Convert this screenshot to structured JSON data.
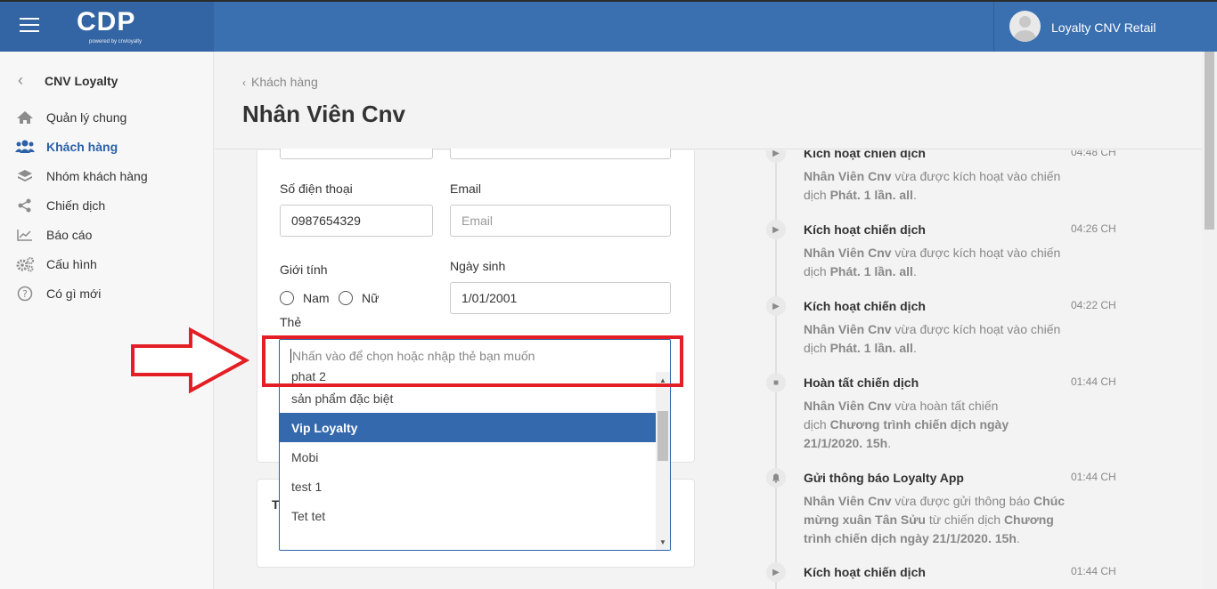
{
  "app": {
    "logo": "CDP",
    "logo_sub": "powered by cnvloyalty",
    "user_name": "Loyalty CNV Retail"
  },
  "sidebar": {
    "header": "CNV Loyalty",
    "items": [
      {
        "label": "Quản lý chung",
        "icon": "home-icon"
      },
      {
        "label": "Khách hàng",
        "icon": "users-icon",
        "active": true
      },
      {
        "label": "Nhóm khách hàng",
        "icon": "layers-icon"
      },
      {
        "label": "Chiến dịch",
        "icon": "share-icon"
      },
      {
        "label": "Báo cáo",
        "icon": "chart-icon"
      },
      {
        "label": "Cấu hình",
        "icon": "gears-icon"
      },
      {
        "label": "Có gì mới",
        "icon": "question-icon"
      }
    ]
  },
  "header": {
    "breadcrumb": "Khách hàng",
    "title": "Nhân Viên Cnv"
  },
  "form": {
    "phone_label": "Số điện thoại",
    "phone_value": "0987654329",
    "email_label": "Email",
    "email_placeholder": "Email",
    "gender_label": "Giới tính",
    "gender_male": "Nam",
    "gender_female": "Nữ",
    "birthday_label": "Ngày sinh",
    "birthday_value": "1/01/2001",
    "tag_label": "Thẻ",
    "tag_placeholder": "Nhấn vào để chọn hoặc nhập thẻ bạn muốn",
    "tag_options": [
      "phat 2",
      "sản phẩm đặc biệt",
      "Vip Loyalty",
      "Mobi",
      "test 1",
      "Tet tet"
    ],
    "tag_selected": "Vip Loyalty",
    "second_card_title": "T"
  },
  "timeline": [
    {
      "title": "Kích hoạt chiến dịch",
      "time": "04:48 CH",
      "icon": "play-icon",
      "desc_name": "Nhân Viên Cnv",
      "desc_mid": " vừa được kích hoạt vào chiến dịch ",
      "desc_target": "Phát. 1 lần. all",
      "desc_end": "."
    },
    {
      "title": "Kích hoạt chiến dịch",
      "time": "04:26 CH",
      "icon": "play-icon",
      "desc_name": "Nhân Viên Cnv",
      "desc_mid": " vừa được kích hoạt vào chiến dịch ",
      "desc_target": "Phát. 1 lần. all",
      "desc_end": "."
    },
    {
      "title": "Kích hoạt chiến dịch",
      "time": "04:22 CH",
      "icon": "play-icon",
      "desc_name": "Nhân Viên Cnv",
      "desc_mid": " vừa được kích hoạt vào chiến dịch ",
      "desc_target": "Phát. 1 lần. all",
      "desc_end": "."
    },
    {
      "title": "Hoàn tất chiến dịch",
      "time": "01:44 CH",
      "icon": "stop-icon",
      "desc_name": "Nhân Viên Cnv",
      "desc_mid": " vừa hoàn tất chiến dịch ",
      "desc_target": "Chương trình chiến dịch ngày 21/1/2020. 15h",
      "desc_end": "."
    },
    {
      "title": "Gửi thông báo Loyalty App",
      "time": "01:44 CH",
      "icon": "bell-icon",
      "desc_name": "Nhân Viên Cnv",
      "desc_mid": " vừa được gửi thông báo ",
      "desc_target": "Chúc mừng xuân Tân Sửu",
      "desc_mid2": " từ chiến dịch ",
      "desc_target2": "Chương trình chiến dịch ngày 21/1/2020. 15h",
      "desc_end": "."
    },
    {
      "title": "Kích hoạt chiến dịch",
      "time": "01:44 CH",
      "icon": "play-icon"
    }
  ],
  "colors": {
    "topbar": "#3a6fb0",
    "accent": "#2c61a8",
    "highlight": "#e31e24"
  }
}
